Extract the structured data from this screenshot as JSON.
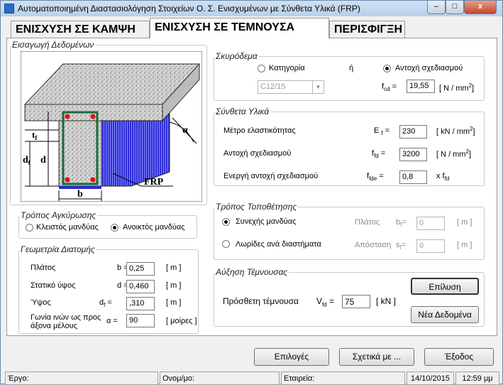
{
  "window": {
    "title": "Αυτοματοποιημένη Διαστασιολόγηση Στοιχείων Ο. Σ. Ενισχυμένων με Σύνθετα Υλικά  (FRP)",
    "min": "–",
    "max": "□",
    "close": "x"
  },
  "tabs": [
    {
      "label": "ΕΝΙΣΧΥΣΗ ΣΕ ΚΑΜΨΗ"
    },
    {
      "label": "ΕΝΙΣΧΥΣΗ ΣΕ ΤΕΜΝΟΥΣΑ"
    },
    {
      "label": "ΠΕΡΙΣΦΙΓΞΗ"
    }
  ],
  "input_group": {
    "legend": "Εισαγωγή Δεδομένων",
    "figure": {
      "tf": "t",
      "tf_sub": "f",
      "df": "d",
      "df_sub": "f",
      "d": "d",
      "b": "b",
      "frp": "FRP",
      "alpha": "α"
    }
  },
  "anchorage": {
    "legend": "Τρόπος Αγκύρωσης",
    "closed": "Κλειστός μανδύας",
    "open": "Ανοικτός μανδύας",
    "selected": "open"
  },
  "geometry": {
    "legend": "Γεωμετρία Διατομής",
    "width_label": "Πλάτος",
    "width_sym": "b =",
    "width_val": "0,25",
    "width_unit": "[ m ]",
    "static_label": "Στατικό ύψος",
    "static_sym": "d =",
    "static_val": "0,460",
    "static_unit": "[ m ]",
    "height_label": "Ύψος",
    "height_sym": "d",
    "height_sub": "f",
    "height_eq": "=",
    "height_val": ",310",
    "height_unit": "[ m ]",
    "angle_label": "Γωνία ινών ως προς άξονα μέλους",
    "angle_sym": "α =",
    "angle_val": "90",
    "angle_unit": "[ μοίρες ]"
  },
  "concrete": {
    "legend": "Σκυρόδεμα",
    "category": "Κατηγορία",
    "or": "ή",
    "strength": "Αντοχή σχεδιασμού",
    "selected": "strength",
    "class_value": "C12/15",
    "fcd_sym": "f",
    "fcd_sub": "cd",
    "fcd_eq": "=",
    "fcd_val": "19,55",
    "fcd_unit": "[ N / mm",
    "fcd_pow": "2",
    "fcd_close": "]"
  },
  "composite": {
    "legend": "Σύνθετα Υλικά",
    "e_label": "Μέτρο ελαστικότητας",
    "e_sym": "E",
    "e_sub": "f",
    "e_eq": "=",
    "e_val": "230",
    "e_unit": "[ kN /  mm",
    "e_pow": "2",
    "e_close": "]",
    "ffd_label": "Αντοχή σχεδιασμού",
    "ffd_sym": "f",
    "ffd_sub": "fd",
    "ffd_eq": "=",
    "ffd_val": "3200",
    "ffd_unit": "[ N / mm",
    "ffd_pow": "2",
    "ffd_close": "]",
    "ffde_label": "Ενεργή αντοχή σχεδιασμού",
    "ffde_sym": "f",
    "ffde_sub": "fde",
    "ffde_eq": "=",
    "ffde_val": "0,8",
    "ffde_unit": "x f",
    "ffde_unit_sub": "fd"
  },
  "placement": {
    "legend": "Τρόπος Τοποθέτησης",
    "continuous": "Συνεχής μανδύας",
    "strips": "Λωρίδες ανά διαστήματα",
    "selected": "continuous",
    "bf_label": "Πλάτος",
    "bf_sym": "b",
    "bf_sub": "f",
    "bf_eq": "=",
    "bf_val": "0",
    "bf_unit": "[ m ]",
    "sf_label": "Απόσταση",
    "sf_sym": "s",
    "sf_sub": "f",
    "sf_eq": "=",
    "sf_val": "0",
    "sf_unit": "[ m ]"
  },
  "shear": {
    "legend": "Αύξηση Τέμνουσας",
    "label": "Πρόσθετη τέμνουσα",
    "sym": "V",
    "sub": "fd",
    "eq": "=",
    "val": "75",
    "unit": "[ kN ]",
    "solve": "Επίλυση",
    "new_data": "Νέα Δεδομένα"
  },
  "footer": {
    "options": "Επιλογές",
    "about": "Σχετικά με ...",
    "exit": "Έξοδος"
  },
  "statusbar": {
    "project": "Έργο:",
    "name": "Ονομ/μο:",
    "company": "Εταιρεία:",
    "date": "14/10/2015",
    "time": "12:59 μμ"
  }
}
